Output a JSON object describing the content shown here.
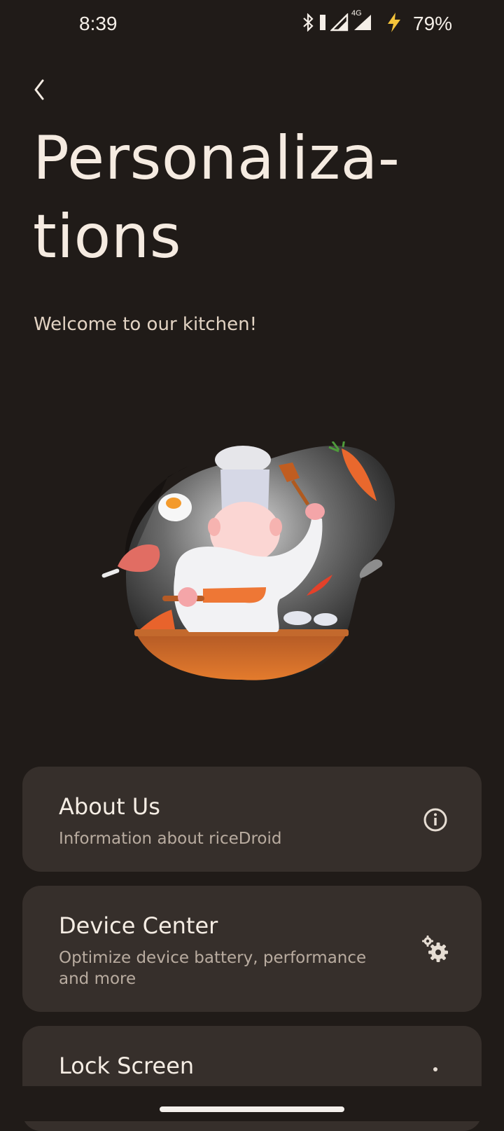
{
  "status_bar": {
    "time": "8:39",
    "battery": "79%",
    "network_label": "4G",
    "icons": [
      "bluetooth-icon",
      "battery-saver-icon",
      "signal-icon",
      "signal-4g-icon",
      "charging-icon"
    ]
  },
  "header": {
    "title": "Personaliza-tions",
    "subtitle": "Welcome to our kitchen!"
  },
  "illustration": {
    "icon": "chef-cooking-illustration"
  },
  "cards": [
    {
      "title": "About Us",
      "summary": "Information about riceDroid",
      "icon": "info-icon"
    },
    {
      "title": "Device Center",
      "summary": "Optimize device battery, performance and more",
      "icon": "gears-icon"
    },
    {
      "title": "Lock Screen",
      "summary": "",
      "icon": "lock-screen-icon"
    }
  ],
  "colors": {
    "background": "#201b18",
    "card": "#362f2b",
    "accent": "#e8722f"
  }
}
